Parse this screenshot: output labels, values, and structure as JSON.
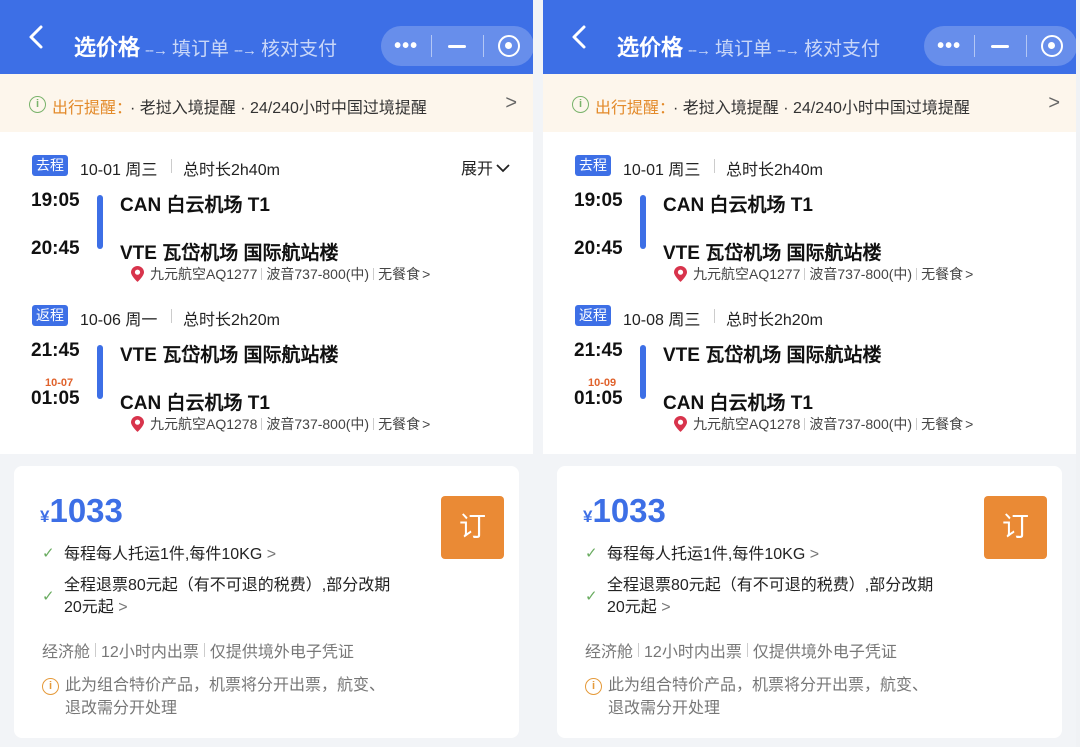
{
  "panels": [
    {
      "nav": {
        "step_active": "选价格",
        "step_2": "填订单",
        "step_3": "核对支付",
        "arrow": "--→"
      },
      "notice": {
        "label": "出行提醒：",
        "text": "· 老挝入境提醒 · 24/240小时中国过境提醒",
        "icon": "info-icon"
      },
      "outbound": {
        "tag": "去程",
        "date": "10-01 周三",
        "duration": "总时长2h40m",
        "expand": "展开",
        "dep_time": "19:05",
        "dep_airport": "CAN 白云机场 T1",
        "arr_time": "20:45",
        "arr_airport": "VTE 瓦岱机场 国际航站楼",
        "arr_nextday": "",
        "airline": "九元航空AQ1277",
        "aircraft": "波音737-800(中)",
        "meal": "无餐食"
      },
      "return": {
        "tag": "返程",
        "date": "10-06 周一",
        "duration": "总时长2h20m",
        "dep_time": "21:45",
        "dep_airport": "VTE 瓦岱机场 国际航站楼",
        "arr_time": "01:05",
        "arr_airport": "CAN 白云机场 T1",
        "arr_nextday": "10-07",
        "airline": "九元航空AQ1278",
        "aircraft": "波音737-800(中)",
        "meal": "无餐食"
      },
      "card": {
        "price_symbol": "¥",
        "price": "1033",
        "book_label": "订",
        "rule_1": "每程每人托运1件,每件10KG",
        "rule_2a": "全程退票80元起（有不可退的税费）,部分改期",
        "rule_2b": "20元起",
        "meta_1": "经济舱",
        "meta_2": "12小时内出票",
        "meta_3": "仅提供境外电子凭证",
        "warning_1": "此为组合特价产品，机票将分开出票，航变、",
        "warning_2": "退改需分开处理"
      }
    },
    {
      "nav": {
        "step_active": "选价格",
        "step_2": "填订单",
        "step_3": "核对支付",
        "arrow": "--→"
      },
      "notice": {
        "label": "出行提醒：",
        "text": "· 老挝入境提醒 · 24/240小时中国过境提醒",
        "icon": "info-icon"
      },
      "outbound": {
        "tag": "去程",
        "date": "10-01 周三",
        "duration": "总时长2h40m",
        "expand": "",
        "dep_time": "19:05",
        "dep_airport": "CAN 白云机场 T1",
        "arr_time": "20:45",
        "arr_airport": "VTE 瓦岱机场 国际航站楼",
        "arr_nextday": "",
        "airline": "九元航空AQ1277",
        "aircraft": "波音737-800(中)",
        "meal": "无餐食"
      },
      "return": {
        "tag": "返程",
        "date": "10-08 周三",
        "duration": "总时长2h20m",
        "dep_time": "21:45",
        "dep_airport": "VTE 瓦岱机场 国际航站楼",
        "arr_time": "01:05",
        "arr_airport": "CAN 白云机场 T1",
        "arr_nextday": "10-09",
        "airline": "九元航空AQ1278",
        "aircraft": "波音737-800(中)",
        "meal": "无餐食"
      },
      "card": {
        "price_symbol": "¥",
        "price": "1033",
        "book_label": "订",
        "rule_1": "每程每人托运1件,每件10KG",
        "rule_2a": "全程退票80元起（有不可退的税费）,部分改期",
        "rule_2b": "20元起",
        "meta_1": "经济舱",
        "meta_2": "12小时内出票",
        "meta_3": "仅提供境外电子凭证",
        "warning_1": "此为组合特价产品，机票将分开出票，航变、",
        "warning_2": "退改需分开处理"
      }
    }
  ],
  "colors": {
    "brand_blue": "#3d6fe6",
    "book_orange": "#ea8a35",
    "notice_bg": "#fdf6ec",
    "check_green": "#6aac61",
    "nextday_red": "#e0622c"
  }
}
